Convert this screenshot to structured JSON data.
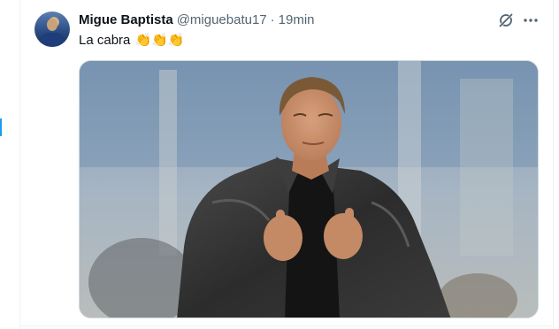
{
  "tweet": {
    "author": {
      "display_name": "Migue Baptista",
      "handle": "@miguebatu17"
    },
    "separator": "·",
    "timestamp": "19min",
    "text": "La cabra",
    "emoji": "👏👏👏",
    "icons": {
      "grok": "grok-icon",
      "more": "more-horizontal-icon"
    }
  },
  "colors": {
    "text_primary": "#0f1419",
    "text_secondary": "#536471",
    "border": "#eff3f4",
    "accent": "#1d9bf0"
  }
}
